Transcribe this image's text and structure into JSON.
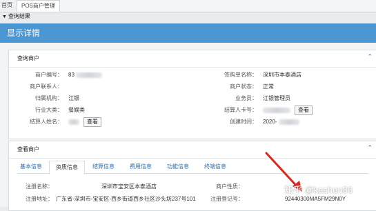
{
  "tabs": [
    {
      "label": "首页"
    },
    {
      "label": "POS商户管理"
    }
  ],
  "query_result": "查询结果",
  "modal": {
    "title": "显示详情"
  },
  "merchant_panel": {
    "title": "查询商户",
    "labels": {
      "merchant_no": "商户编号：",
      "sign_name": "签购单名称：",
      "contact": "商户联系人：",
      "status": "商户状态：",
      "org": "归属机构：",
      "salesman": "业务员：",
      "category": "行业大类：",
      "card_no": "结算人卡号：",
      "settle_name": "结算人姓名：",
      "created": "创建时间："
    },
    "values": {
      "merchant_no": "83",
      "sign_name": "深圳市本泰酒店",
      "contact": "",
      "status": "正常",
      "org": "江银",
      "salesman": "江银管理员",
      "category": "餐娱类",
      "created": "2020-"
    },
    "view_button": "查看"
  },
  "detail_panel": {
    "title": "查看商户",
    "subtabs": [
      "基本信息",
      "资质信息",
      "结算信息",
      "费用信息",
      "功能信息",
      "终端信息"
    ],
    "labels": {
      "reg_name": "注册名称：",
      "nature": "商户性质：",
      "reg_addr": "注册地址：",
      "reg_no": "注册登记号："
    },
    "values": {
      "reg_name": "深圳市宝安区本泰酒店",
      "reg_addr": "广东省-深圳市-宝安区-西乡街道西乡社区沙头坊237号101",
      "reg_no": "92440300MA5FM29N0Y"
    }
  },
  "watermark": "知乎 @kashen86"
}
